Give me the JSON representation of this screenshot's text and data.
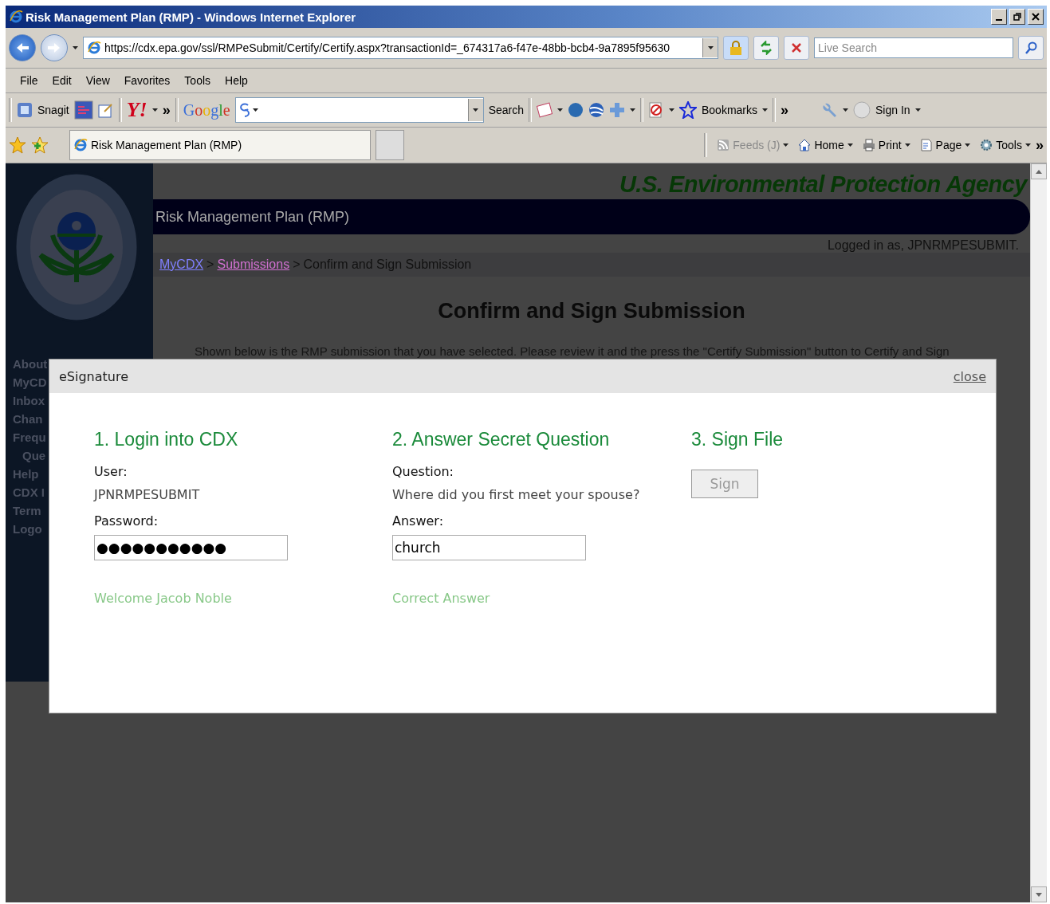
{
  "window": {
    "title": "Risk Management Plan (RMP) - Windows Internet Explorer"
  },
  "address_bar": {
    "url": "https://cdx.epa.gov/ssl/RMPeSubmit/Certify/Certify.aspx?transactionId=_674317a6-f47e-48bb-bcb4-9a7895f95630"
  },
  "search": {
    "placeholder": "Live Search"
  },
  "menu": [
    "File",
    "Edit",
    "View",
    "Favorites",
    "Tools",
    "Help"
  ],
  "toolbar": {
    "snagit": "Snagit",
    "yahoo_logo": "Y!",
    "more": "»",
    "google_logo": "Google",
    "google_search": "Search",
    "bookmarks": "Bookmarks",
    "more_2": "»",
    "sign_in": "Sign In"
  },
  "tab": {
    "title": "Risk Management Plan (RMP)"
  },
  "command_bar": [
    {
      "label": "Feeds (J)",
      "disabled": true
    },
    {
      "label": "Home",
      "disabled": false
    },
    {
      "label": "Print",
      "disabled": false
    },
    {
      "label": "Page",
      "disabled": false
    },
    {
      "label": "Tools",
      "disabled": false
    }
  ],
  "command_more": "»",
  "page": {
    "agency": "U.S. Environmental Protection Agency",
    "banner": "Risk Management Plan (RMP)",
    "logged_in": "Logged in as, JPNRMPESUBMIT.",
    "breadcrumb_separator": ">",
    "breadcrumb": [
      {
        "label": "MyCDX",
        "link": true,
        "visited": false
      },
      {
        "label": "Submissions",
        "link": true,
        "visited": true
      },
      {
        "label": "Confirm and Sign Submission",
        "link": false,
        "visited": false
      }
    ],
    "heading": "Confirm and Sign Submission",
    "intro": "Shown below is the RMP submission that you have selected. Please review it and the press the \"Certify Submission\" button to Certify and Sign",
    "sidebar": [
      "About",
      "MyCD",
      "Inbox",
      "Chan",
      "Frequ",
      "Que",
      "Help",
      "CDX I",
      "Term",
      "Logo"
    ]
  },
  "modal": {
    "title": "eSignature",
    "close": "close",
    "steps": [
      {
        "kind": "login",
        "title": "1. Login into CDX",
        "user_label": "User:",
        "user": "JPNRMPESUBMIT",
        "password_label": "Password:",
        "password": "●●●●●●●●●●●",
        "message": "Welcome Jacob Noble"
      },
      {
        "kind": "question",
        "title": "2. Answer Secret Question",
        "question_label": "Question:",
        "question": "Where did you first meet your spouse?",
        "answer_label": "Answer:",
        "answer": "church",
        "message": "Correct Answer"
      },
      {
        "kind": "sign",
        "title": "3. Sign File",
        "button": "Sign",
        "disabled": true
      }
    ]
  }
}
